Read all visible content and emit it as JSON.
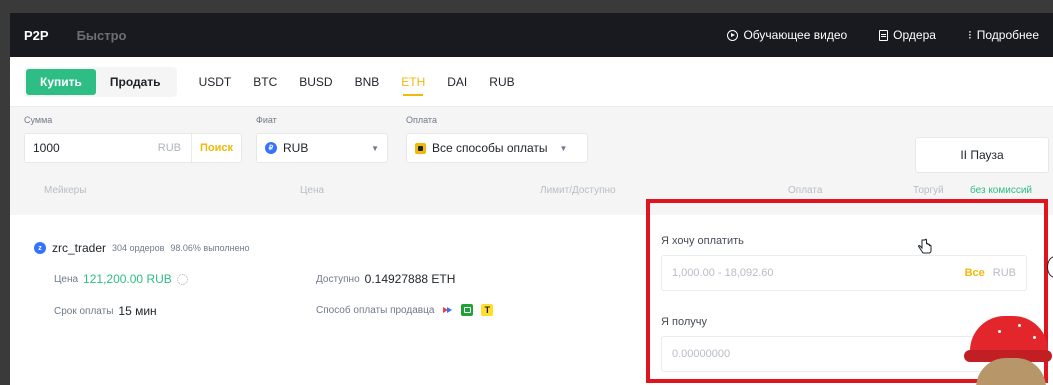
{
  "topbar": {
    "tabs": [
      {
        "label": "P2P",
        "active": true
      },
      {
        "label": "Быстро",
        "active": false
      }
    ],
    "links": [
      {
        "label": "Обучающее видео",
        "icon": "play-circle-icon"
      },
      {
        "label": "Ордера",
        "icon": "document-icon"
      },
      {
        "label": "Подробнее",
        "icon": "more-icon"
      }
    ]
  },
  "filter": {
    "buy_label": "Купить",
    "sell_label": "Продать",
    "coins": [
      "USDT",
      "BTC",
      "BUSD",
      "BNB",
      "ETH",
      "DAI",
      "RUB"
    ],
    "active_coin": "ETH"
  },
  "form": {
    "amount_label": "Сумма",
    "amount_value": "1000",
    "amount_currency": "RUB",
    "search_label": "Поиск",
    "fiat_label": "Фиат",
    "fiat_value": "RUB",
    "payment_label": "Оплата",
    "payment_value": "Все способы оплаты",
    "pause_label": "II Пауза"
  },
  "table_headers": {
    "makers": "Мейкеры",
    "price": "Цена",
    "limit": "Лимит/Доступно",
    "payment": "Оплата",
    "trade": "Торгуй",
    "no_fee": "без комиссий"
  },
  "offer": {
    "avatar_letter": "z",
    "name": "zrc_trader",
    "orders": "304 ордеров",
    "completion": "98.06% выполнено",
    "price_label": "Цена",
    "price_value": "121,200.00 RUB",
    "available_label": "Доступно",
    "available_value": "0.14927888 ETH",
    "term_label": "Срок оплаты",
    "term_value": "15 мин",
    "seller_payment_label": "Способ оплаты продавца",
    "payment_badge": "T"
  },
  "order_panel": {
    "pay_label": "Я хочу оплатить",
    "pay_placeholder": "1,000.00 - 18,092.60",
    "all_label": "Все",
    "pay_currency": "RUB",
    "receive_label": "Я получу",
    "receive_placeholder": "0.00000000"
  },
  "colors": {
    "accent": "#f0b90b",
    "buy_green": "#2ebd85",
    "highlight_red": "#e0141e",
    "topbar_bg": "#181a20"
  }
}
